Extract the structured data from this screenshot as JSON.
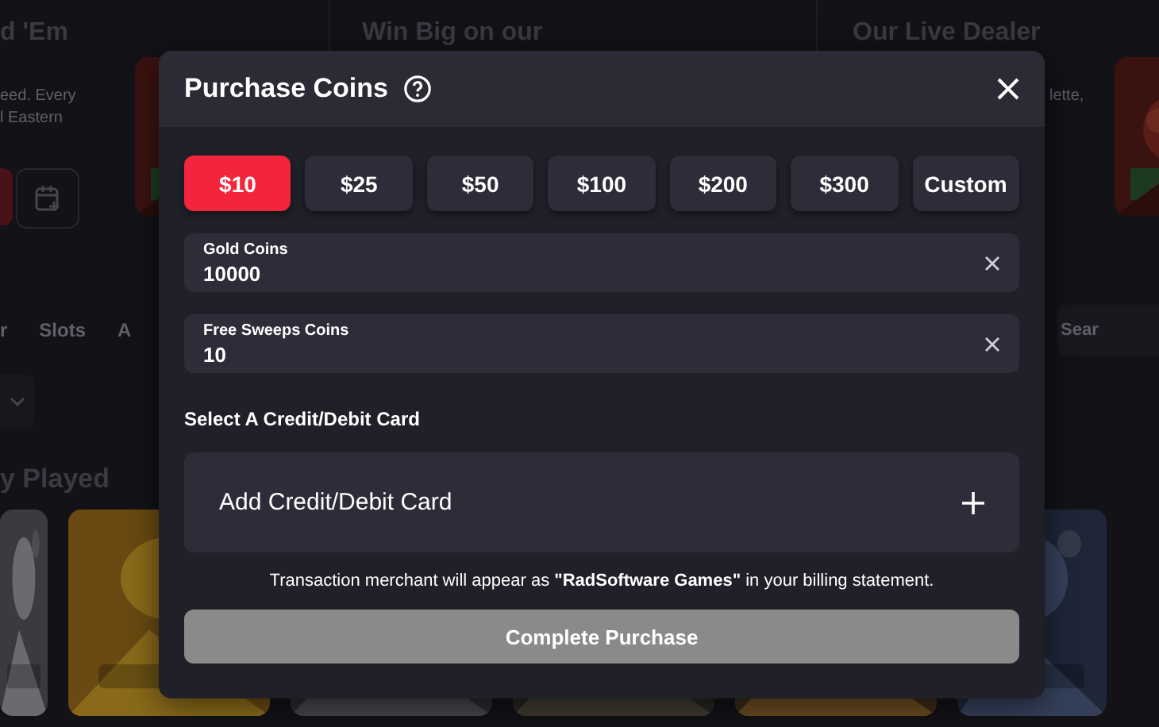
{
  "background": {
    "promos": [
      {
        "title": "d 'Em",
        "description": [
          "eed. Every",
          "l Eastern"
        ]
      },
      {
        "title": "Win Big on our"
      },
      {
        "title": "Our Live Dealer",
        "description": [
          "lette,"
        ]
      }
    ],
    "nav": [
      "r",
      "Slots",
      "A"
    ],
    "search": {
      "placeholder": "Sear"
    },
    "section_title": "y Played"
  },
  "dialog": {
    "title": "Purchase Coins",
    "amounts": [
      {
        "label": "$10",
        "selected": true
      },
      {
        "label": "$25",
        "selected": false
      },
      {
        "label": "$50",
        "selected": false
      },
      {
        "label": "$100",
        "selected": false
      },
      {
        "label": "$200",
        "selected": false
      },
      {
        "label": "$300",
        "selected": false
      },
      {
        "label": "Custom",
        "selected": false
      }
    ],
    "fields": [
      {
        "label": "Gold Coins",
        "value": "10000"
      },
      {
        "label": "Free Sweeps Coins",
        "value": "10"
      }
    ],
    "card_heading": "Select A Credit/Debit Card",
    "add_card": "Add Credit/Debit Card",
    "note": "Transaction merchant will appear as **\"RadSoftware Games\"** in your billing statement.",
    "submit": {
      "label": "Complete Purchase",
      "disabled": true
    }
  }
}
